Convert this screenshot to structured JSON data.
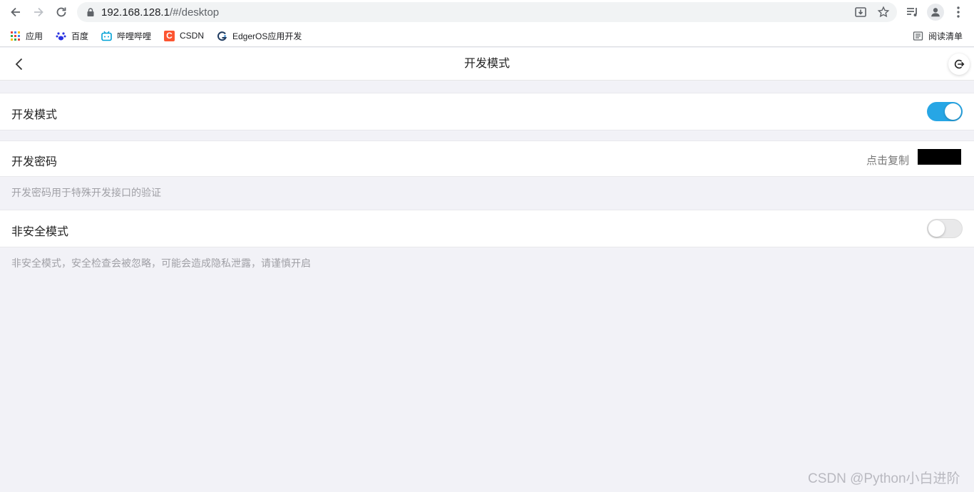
{
  "browser": {
    "url_host": "192.168.128.1",
    "url_path": "/#/desktop",
    "bookmarks": [
      {
        "label": "应用",
        "icon": "apps-grid-icon"
      },
      {
        "label": "百度",
        "icon": "baidu-paw-icon"
      },
      {
        "label": "哔哩哔哩",
        "icon": "bilibili-tv-icon"
      },
      {
        "label": "CSDN",
        "icon": "csdn-c-icon"
      },
      {
        "label": "EdgerOS应用开发",
        "icon": "edgeros-g-icon"
      }
    ],
    "reading_list": "阅读清单"
  },
  "header": {
    "title": "开发模式"
  },
  "rows": {
    "dev_mode": {
      "label": "开发模式",
      "enabled": true
    },
    "dev_password": {
      "label": "开发密码",
      "copy_label": "点击复制"
    },
    "dev_password_hint": "开发密码用于特殊开发接口的验证",
    "insecure_mode": {
      "label": "非安全模式",
      "enabled": false
    },
    "insecure_mode_hint": "非安全模式，安全检查会被忽略，可能会造成隐私泄露，请谨慎开启"
  },
  "colors": {
    "accent": "#27a6e5",
    "background": "#f2f2f7"
  },
  "watermark": "CSDN @Python小白进阶"
}
